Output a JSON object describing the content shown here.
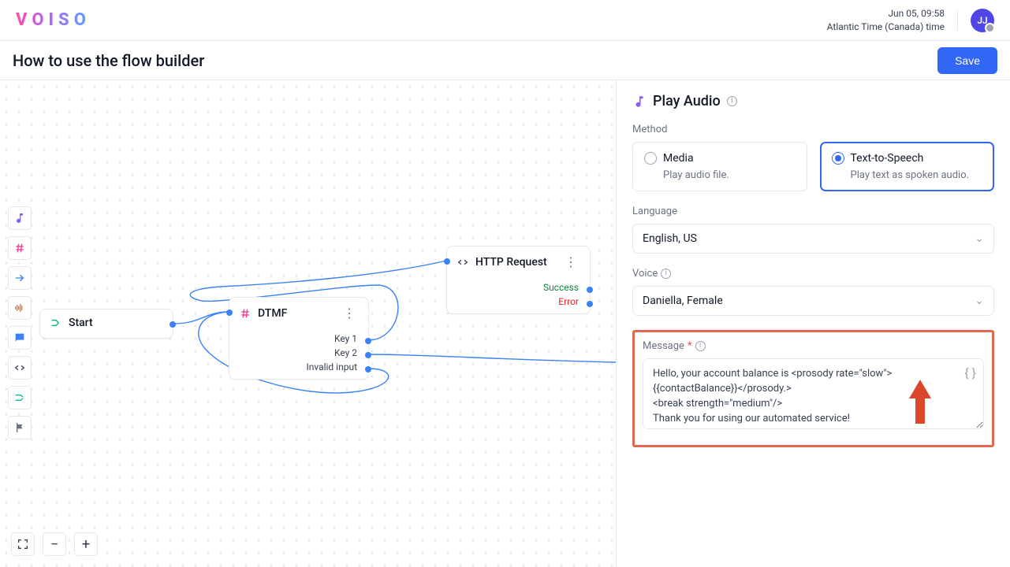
{
  "header": {
    "time": "Jun 05, 09:58",
    "timezone": "Atlantic Time (Canada) time",
    "avatar_initials": "JJ"
  },
  "title_bar": {
    "title": "How to use the flow builder",
    "save_label": "Save"
  },
  "nodes": {
    "start": {
      "label": "Start"
    },
    "dtmf": {
      "label": "DTMF",
      "out1": "Key 1",
      "out2": "Key 2",
      "out3": "Invalid input"
    },
    "http": {
      "label": "HTTP Request",
      "outSuccess": "Success",
      "outError": "Error"
    }
  },
  "panel": {
    "title": "Play Audio",
    "method_label": "Method",
    "method_media_title": "Media",
    "method_media_sub": "Play audio file.",
    "method_tts_title": "Text-to-Speech",
    "method_tts_sub": "Play text as spoken audio.",
    "language_label": "Language",
    "language_value": "English, US",
    "voice_label": "Voice",
    "voice_value": "Daniella, Female",
    "message_label": "Message",
    "message_value": "Hello, your account balance is <prosody rate=\"slow\">{{contactBalance}}</prosody.>\n<break strength=\"medium\"/>\nThank you for using our automated service!"
  }
}
